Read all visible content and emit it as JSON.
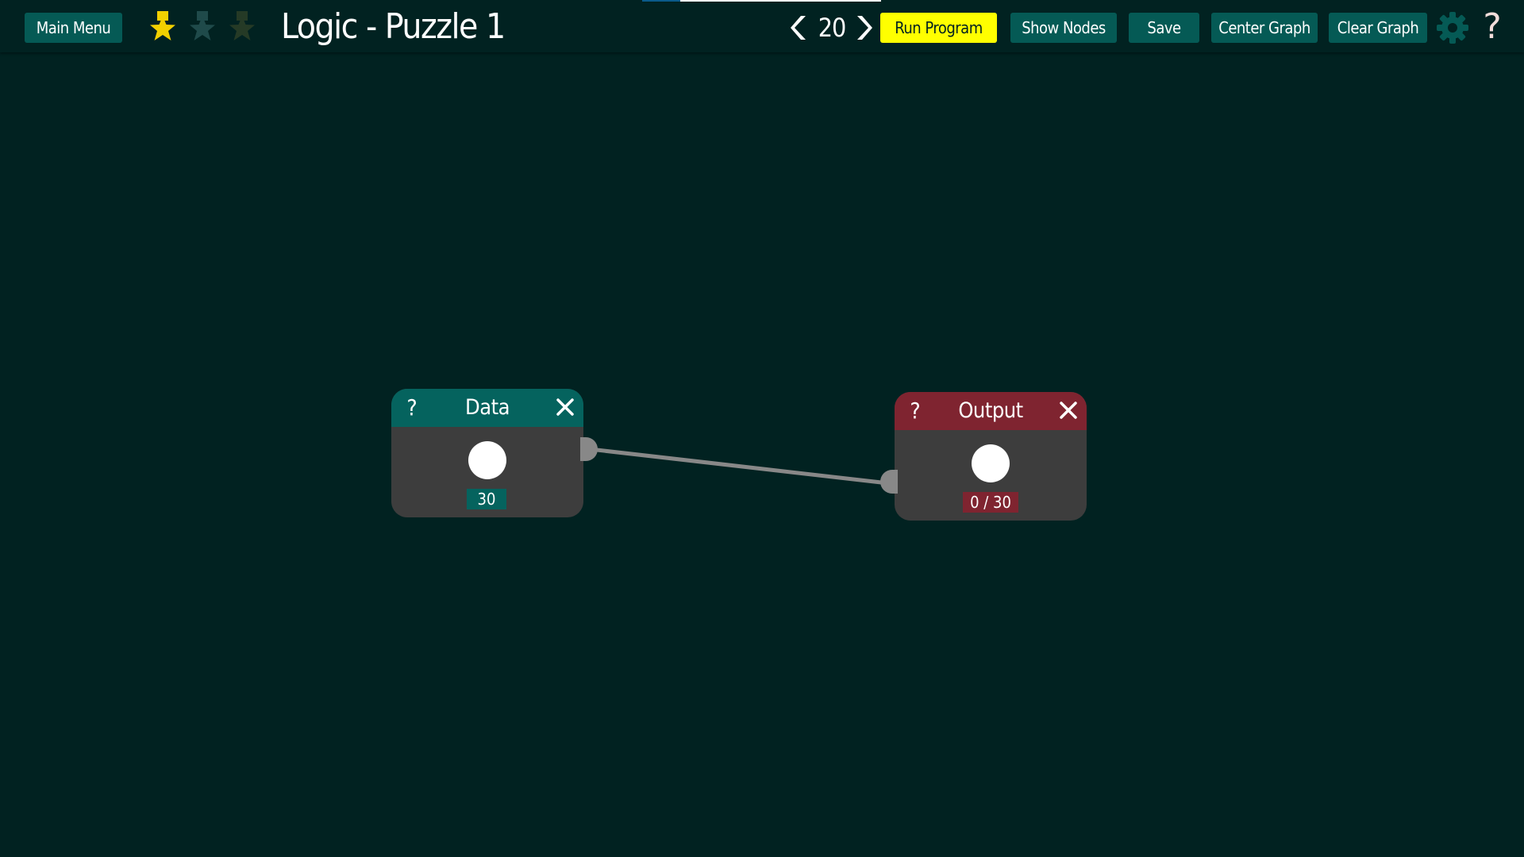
{
  "toolbar": {
    "main_menu_label": "Main Menu",
    "title": "Logic - Puzzle 1",
    "speed_value": "20",
    "run_label": "Run Program",
    "show_nodes_label": "Show Nodes",
    "save_label": "Save",
    "center_graph_label": "Center Graph",
    "clear_graph_label": "Clear Graph",
    "help_label": "?",
    "progress_fraction": 0.16
  },
  "stars": {
    "earned": 1,
    "total": 3,
    "colors": {
      "earned": "#f2d000",
      "unearned_mid": "#1f4a4a",
      "unearned_dark": "#253a26"
    }
  },
  "nodes": {
    "data": {
      "help": "?",
      "title": "Data",
      "count": "30",
      "header_color": "#05635e"
    },
    "output": {
      "help": "?",
      "title": "Output",
      "count": "0 / 30",
      "header_color": "#7f2430"
    }
  },
  "colors": {
    "background": "#012221",
    "button": "#055a55",
    "run_button": "#ffff00",
    "node_body": "#3d3d3d",
    "wire": "#888888"
  },
  "icons": [
    "star-icon",
    "chevron-left-icon",
    "chevron-right-icon",
    "gear-icon",
    "help-icon",
    "close-icon"
  ]
}
